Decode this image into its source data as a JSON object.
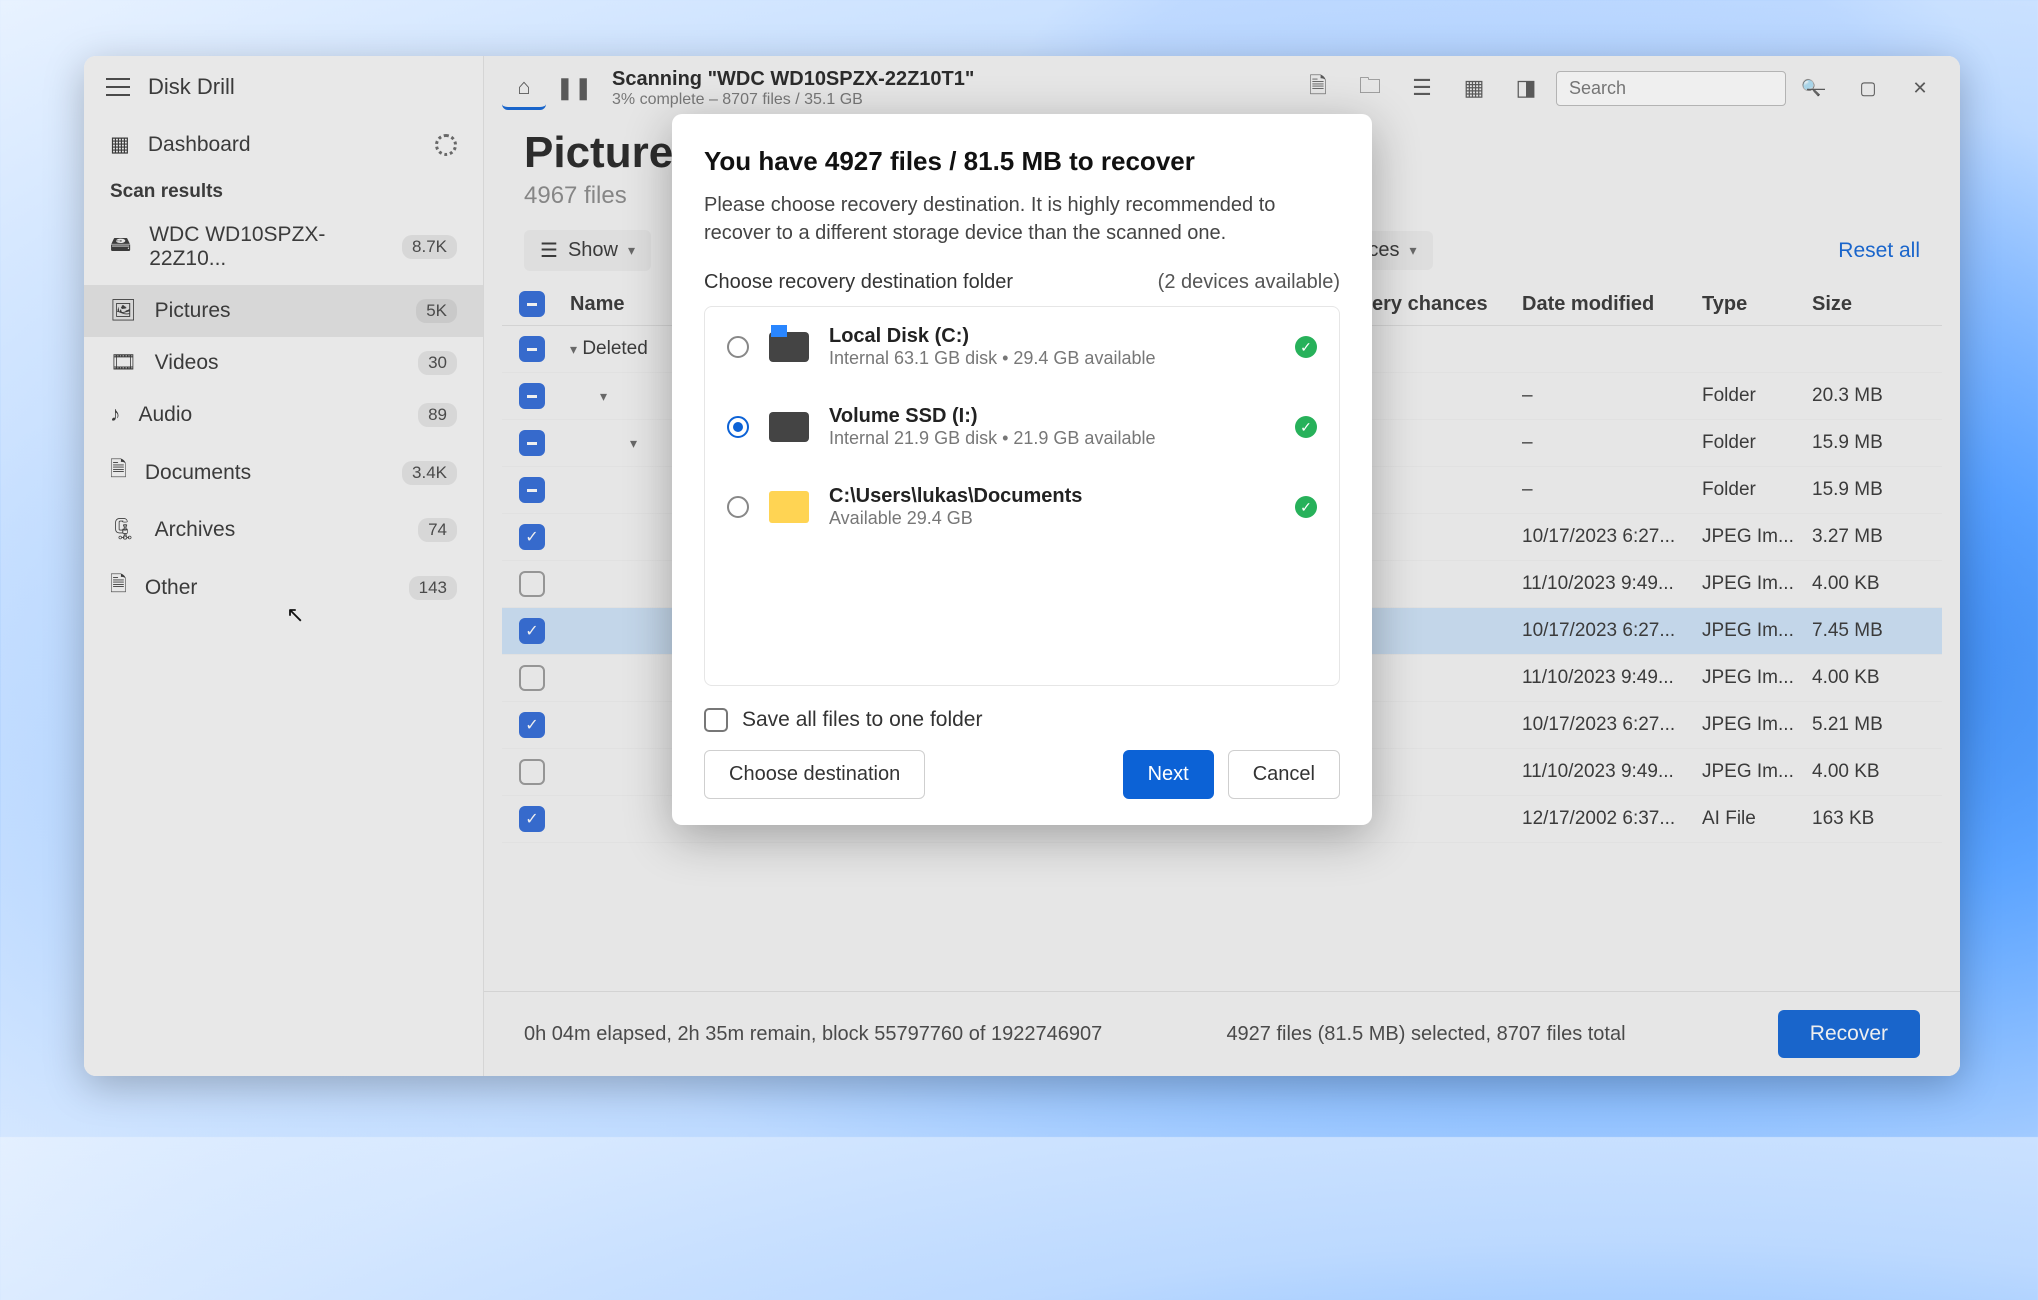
{
  "app_title": "Disk Drill",
  "sidebar": {
    "dashboard": "Dashboard",
    "section": "Scan results",
    "items": [
      {
        "label": "WDC WD10SPZX-22Z10...",
        "count": "8.7K"
      },
      {
        "label": "Pictures",
        "count": "5K"
      },
      {
        "label": "Videos",
        "count": "30"
      },
      {
        "label": "Audio",
        "count": "89"
      },
      {
        "label": "Documents",
        "count": "3.4K"
      },
      {
        "label": "Archives",
        "count": "74"
      },
      {
        "label": "Other",
        "count": "143"
      }
    ]
  },
  "scan": {
    "title": "Scanning \"WDC WD10SPZX-22Z10T1\"",
    "sub": "3% complete – 8707 files / 35.1 GB"
  },
  "search_placeholder": "Search",
  "page": {
    "title": "Pictures",
    "sub": "4967 files"
  },
  "filters": {
    "show": "Show",
    "chances": "chances",
    "reset": "Reset all"
  },
  "columns": {
    "name": "Name",
    "rc": "Recovery chances",
    "dm": "Date modified",
    "ty": "Type",
    "sz": "Size"
  },
  "rows": [
    {
      "cb": "ind",
      "exp": "▾",
      "name": "Deleted",
      "rc": "",
      "dm": "",
      "ty": "",
      "sz": ""
    },
    {
      "cb": "ind",
      "exp": "▾",
      "name": "",
      "rc": "",
      "dm": "–",
      "ty": "Folder",
      "sz": "20.3 MB",
      "indent": 1
    },
    {
      "cb": "ind",
      "exp": "▾",
      "name": "",
      "rc": "",
      "dm": "–",
      "ty": "Folder",
      "sz": "15.9 MB",
      "indent": 2
    },
    {
      "cb": "ind",
      "exp": "",
      "name": "",
      "rc": "",
      "dm": "–",
      "ty": "Folder",
      "sz": "15.9 MB",
      "indent": 3
    },
    {
      "cb": "chk",
      "exp": "",
      "name": "",
      "rc": "",
      "dm": "10/17/2023 6:27...",
      "ty": "JPEG Im...",
      "sz": "3.27 MB",
      "indent": 3
    },
    {
      "cb": "emp",
      "exp": "",
      "name": "",
      "rc": "",
      "dm": "11/10/2023 9:49...",
      "ty": "JPEG Im...",
      "sz": "4.00 KB",
      "indent": 3
    },
    {
      "cb": "chk",
      "exp": "",
      "name": "",
      "rc": "",
      "dm": "10/17/2023 6:27...",
      "ty": "JPEG Im...",
      "sz": "7.45 MB",
      "indent": 3,
      "sel": true
    },
    {
      "cb": "emp",
      "exp": "",
      "name": "",
      "rc": "",
      "dm": "11/10/2023 9:49...",
      "ty": "JPEG Im...",
      "sz": "4.00 KB",
      "indent": 3
    },
    {
      "cb": "chk",
      "exp": "",
      "name": "",
      "rc": "",
      "dm": "10/17/2023 6:27...",
      "ty": "JPEG Im...",
      "sz": "5.21 MB",
      "indent": 3
    },
    {
      "cb": "emp",
      "exp": "",
      "name": "",
      "rc": "",
      "dm": "11/10/2023 9:49...",
      "ty": "JPEG Im...",
      "sz": "4.00 KB",
      "indent": 3
    },
    {
      "cb": "chk",
      "exp": "",
      "name": "",
      "rc": "",
      "dm": "12/17/2002 6:37...",
      "ty": "AI File",
      "sz": "163 KB",
      "indent": 3
    }
  ],
  "status": {
    "left": "0h 04m elapsed, 2h 35m remain, block 55797760 of 1922746907",
    "right": "4927 files (81.5 MB) selected, 8707 files total",
    "recover": "Recover"
  },
  "modal": {
    "title": "You have 4927 files / 81.5 MB to recover",
    "desc": "Please choose recovery destination. It is highly recommended to recover to a different storage device than the scanned one.",
    "choose": "Choose recovery destination folder",
    "devices": "(2 devices available)",
    "destinations": [
      {
        "name": "Local Disk (C:)",
        "sub": "Internal 63.1 GB disk • 29.4 GB available",
        "selected": false,
        "icon": "c"
      },
      {
        "name": "Volume SSD (I:)",
        "sub": "Internal 21.9 GB disk • 21.9 GB available",
        "selected": true,
        "icon": "d"
      },
      {
        "name": "C:\\Users\\lukas\\Documents",
        "sub": "Available 29.4 GB",
        "selected": false,
        "icon": "folder"
      }
    ],
    "save_all": "Save all files to one folder",
    "choose_btn": "Choose destination",
    "next": "Next",
    "cancel": "Cancel"
  }
}
